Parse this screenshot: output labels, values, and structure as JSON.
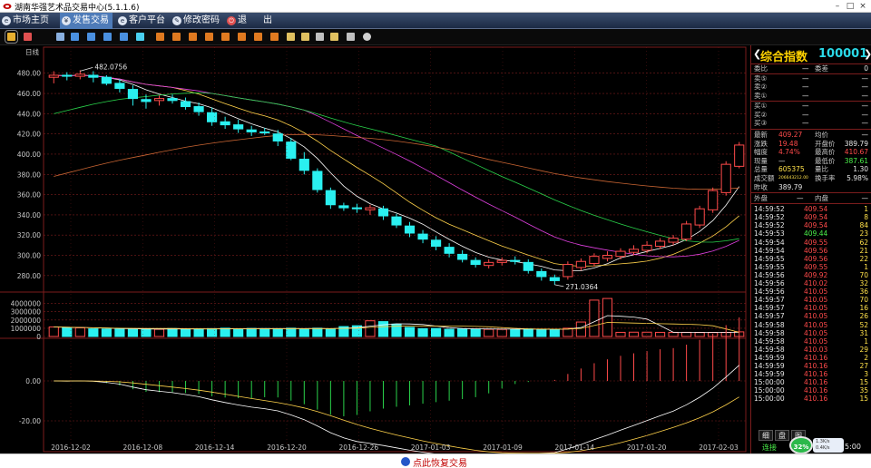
{
  "window": {
    "title": "湖南华强艺术品交易中心(5.1.1.6)",
    "buttons": [
      "–",
      "□",
      "×"
    ]
  },
  "menu": [
    {
      "label": "市场主页",
      "icon": "home-icon",
      "active": false
    },
    {
      "label": "发售交易",
      "icon": "trade-icon",
      "active": true
    },
    {
      "label": "客户平台",
      "icon": "client-icon",
      "active": false
    },
    {
      "label": "修改密码",
      "icon": "key-icon",
      "active": false
    },
    {
      "label": "退",
      "icon": "exit-icon",
      "active": false
    },
    {
      "label": "出",
      "icon": "",
      "active": false
    }
  ],
  "chart_data": {
    "type": "candlestick",
    "period_label": "日线",
    "dates": [
      "2016-12-02",
      "2016-12-08",
      "2016-12-14",
      "2016-12-20",
      "2016-12-26",
      "2017-01-03",
      "2017-01-09",
      "2017-01-14",
      "2017-01-20",
      "2017-02-03"
    ],
    "price_ticks": [
      "480.00",
      "460.00",
      "440.00",
      "420.00",
      "400.00",
      "380.00",
      "360.00",
      "340.00",
      "320.00",
      "300.00",
      "280.00"
    ],
    "high_label": "482.0756",
    "low_label": "271.0364",
    "ylim": [
      270,
      495
    ],
    "candles": [
      {
        "o": 476,
        "c": 478,
        "h": 482,
        "l": 470
      },
      {
        "o": 478,
        "c": 477,
        "h": 481,
        "l": 473
      },
      {
        "o": 477,
        "c": 479,
        "h": 483,
        "l": 474
      },
      {
        "o": 478,
        "c": 476,
        "h": 482,
        "l": 471
      },
      {
        "o": 476,
        "c": 470,
        "h": 478,
        "l": 468
      },
      {
        "o": 470,
        "c": 465,
        "h": 474,
        "l": 461
      },
      {
        "o": 464,
        "c": 455,
        "h": 468,
        "l": 448
      },
      {
        "o": 454,
        "c": 452,
        "h": 459,
        "l": 445
      },
      {
        "o": 453,
        "c": 455,
        "h": 458,
        "l": 448
      },
      {
        "o": 455,
        "c": 453,
        "h": 459,
        "l": 450
      },
      {
        "o": 452,
        "c": 447,
        "h": 456,
        "l": 444
      },
      {
        "o": 447,
        "c": 442,
        "h": 451,
        "l": 438
      },
      {
        "o": 441,
        "c": 432,
        "h": 446,
        "l": 428
      },
      {
        "o": 432,
        "c": 429,
        "h": 437,
        "l": 425
      },
      {
        "o": 429,
        "c": 425,
        "h": 434,
        "l": 421
      },
      {
        "o": 424,
        "c": 422,
        "h": 428,
        "l": 418
      },
      {
        "o": 422,
        "c": 421,
        "h": 426,
        "l": 419
      },
      {
        "o": 420,
        "c": 413,
        "h": 424,
        "l": 408
      },
      {
        "o": 412,
        "c": 396,
        "h": 416,
        "l": 394
      },
      {
        "o": 395,
        "c": 384,
        "h": 402,
        "l": 380
      },
      {
        "o": 383,
        "c": 365,
        "h": 386,
        "l": 362
      },
      {
        "o": 364,
        "c": 350,
        "h": 367,
        "l": 346
      },
      {
        "o": 349,
        "c": 347,
        "h": 352,
        "l": 344
      },
      {
        "o": 347,
        "c": 346,
        "h": 351,
        "l": 342
      },
      {
        "o": 345,
        "c": 347,
        "h": 350,
        "l": 340
      },
      {
        "o": 346,
        "c": 339,
        "h": 349,
        "l": 335
      },
      {
        "o": 338,
        "c": 330,
        "h": 341,
        "l": 327
      },
      {
        "o": 329,
        "c": 322,
        "h": 333,
        "l": 318
      },
      {
        "o": 321,
        "c": 316,
        "h": 325,
        "l": 312
      },
      {
        "o": 315,
        "c": 309,
        "h": 319,
        "l": 305
      },
      {
        "o": 308,
        "c": 302,
        "h": 312,
        "l": 298
      },
      {
        "o": 301,
        "c": 296,
        "h": 305,
        "l": 293
      },
      {
        "o": 295,
        "c": 291,
        "h": 298,
        "l": 288
      },
      {
        "o": 290,
        "c": 293,
        "h": 296,
        "l": 287
      },
      {
        "o": 293,
        "c": 295,
        "h": 298,
        "l": 290
      },
      {
        "o": 295,
        "c": 294,
        "h": 299,
        "l": 291
      },
      {
        "o": 293,
        "c": 285,
        "h": 296,
        "l": 282
      },
      {
        "o": 284,
        "c": 279,
        "h": 287,
        "l": 275
      },
      {
        "o": 278,
        "c": 275,
        "h": 281,
        "l": 271
      },
      {
        "o": 279,
        "c": 291,
        "h": 294,
        "l": 276
      },
      {
        "o": 288,
        "c": 294,
        "h": 297,
        "l": 285
      },
      {
        "o": 292,
        "c": 299,
        "h": 302,
        "l": 289
      },
      {
        "o": 297,
        "c": 300,
        "h": 304,
        "l": 294
      },
      {
        "o": 299,
        "c": 304,
        "h": 307,
        "l": 296
      },
      {
        "o": 303,
        "c": 306,
        "h": 310,
        "l": 300
      },
      {
        "o": 305,
        "c": 310,
        "h": 314,
        "l": 302
      },
      {
        "o": 309,
        "c": 314,
        "h": 317,
        "l": 306
      },
      {
        "o": 313,
        "c": 317,
        "h": 320,
        "l": 310
      },
      {
        "o": 316,
        "c": 331,
        "h": 334,
        "l": 314
      },
      {
        "o": 330,
        "c": 346,
        "h": 349,
        "l": 327
      },
      {
        "o": 345,
        "c": 364,
        "h": 367,
        "l": 342
      },
      {
        "o": 362,
        "c": 390,
        "h": 393,
        "l": 359
      },
      {
        "o": 388,
        "c": 409,
        "h": 412,
        "l": 386
      }
    ],
    "ma_colors": [
      "#ffffff",
      "#ffd24a",
      "#e040e0",
      "#29d24a",
      "#c86432"
    ],
    "volume_ticks": [
      "4000000",
      "3000000",
      "2000000",
      "1000000",
      "0"
    ],
    "volume_max": 4500000,
    "volumes": [
      1150000,
      1100000,
      1050000,
      920000,
      900000,
      880000,
      920000,
      930000,
      870000,
      960000,
      880000,
      930000,
      950000,
      1000000,
      920000,
      970000,
      950000,
      940000,
      1000000,
      920000,
      1000000,
      880000,
      1200000,
      1300000,
      1900000,
      1800000,
      1500000,
      1100000,
      950000,
      970000,
      880000,
      920000,
      900000,
      870000,
      860000,
      880000,
      920000,
      850000,
      870000,
      1000000,
      1750000,
      4400000,
      4600000,
      500000,
      520000,
      520000,
      500000,
      500000,
      500000,
      480000,
      480000,
      490000,
      560000
    ],
    "macd_ticks": [
      "0.00",
      "-20.00"
    ],
    "macd_range": [
      -30,
      20
    ]
  },
  "quote_panel": {
    "name": "综合指数",
    "code": "100001",
    "order_rows": [
      {
        "label": "委比",
        "value": "—",
        "label2": "委差",
        "value2": "0"
      },
      {
        "label": "卖⑤",
        "value": "—",
        "value2": "—"
      },
      {
        "label": "卖②",
        "value": "—",
        "value2": "—"
      },
      {
        "label": "卖①",
        "value": "—",
        "value2": "—"
      },
      {
        "label": "买①",
        "value": "—",
        "value2": "—"
      },
      {
        "label": "买②",
        "value": "—",
        "value2": "—"
      },
      {
        "label": "买③",
        "value": "—",
        "value2": "—"
      }
    ],
    "stats": [
      {
        "l1": "最新",
        "v1": "409.27",
        "l2": "均价",
        "v2": "—"
      },
      {
        "l1": "涨跌",
        "v1": "19.48",
        "l2": "开盘价",
        "v2": "389.79"
      },
      {
        "l1": "幅度",
        "v1": "4.74%",
        "l2": "最高价",
        "v2": "410.67"
      },
      {
        "l1": "现量",
        "v1": "—",
        "l2": "最低价",
        "v2": "387.61"
      },
      {
        "l1": "总量",
        "v1": "605375",
        "l2": "量比",
        "v2": "1.30"
      },
      {
        "l1": "成交额",
        "v1": "206643212.00",
        "l2": "换手率",
        "v2": "5.98%"
      },
      {
        "l1": "昨收",
        "v1": "389.79",
        "l2": "",
        "v2": ""
      }
    ],
    "outer_label": "外盘",
    "outer_value": "—",
    "inner_label": "内盘",
    "inner_value": "—",
    "ticks": [
      {
        "t": "14:59:52",
        "p": "409.54",
        "q": "1"
      },
      {
        "t": "14:59:52",
        "p": "409.54",
        "q": "8"
      },
      {
        "t": "14:59:52",
        "p": "409.54",
        "q": "84"
      },
      {
        "t": "14:59:53",
        "p": "409.44",
        "q": "23"
      },
      {
        "t": "14:59:54",
        "p": "409.55",
        "q": "62"
      },
      {
        "t": "14:59:54",
        "p": "409.56",
        "q": "21"
      },
      {
        "t": "14:59:55",
        "p": "409.56",
        "q": "22"
      },
      {
        "t": "14:59:55",
        "p": "409.55",
        "q": "1"
      },
      {
        "t": "14:59:56",
        "p": "409.92",
        "q": "70"
      },
      {
        "t": "14:59:56",
        "p": "410.02",
        "q": "32"
      },
      {
        "t": "14:59:56",
        "p": "410.05",
        "q": "36"
      },
      {
        "t": "14:59:57",
        "p": "410.05",
        "q": "70"
      },
      {
        "t": "14:59:57",
        "p": "410.05",
        "q": "16"
      },
      {
        "t": "14:59:57",
        "p": "410.05",
        "q": "26"
      },
      {
        "t": "14:59:58",
        "p": "410.05",
        "q": "52"
      },
      {
        "t": "14:59:58",
        "p": "410.05",
        "q": "31"
      },
      {
        "t": "14:59:58",
        "p": "410.05",
        "q": "1"
      },
      {
        "t": "14:59:58",
        "p": "410.03",
        "q": "29"
      },
      {
        "t": "14:59:59",
        "p": "410.16",
        "q": "2"
      },
      {
        "t": "14:59:59",
        "p": "410.16",
        "q": "27"
      },
      {
        "t": "14:59:59",
        "p": "410.16",
        "q": "3"
      },
      {
        "t": "15:00:00",
        "p": "410.16",
        "q": "15"
      },
      {
        "t": "15:00:00",
        "p": "410.16",
        "q": "35"
      },
      {
        "t": "15:00:00",
        "p": "410.16",
        "q": "15"
      }
    ],
    "tabs": [
      "细",
      "盘",
      "图"
    ],
    "status": {
      "connection": "连接",
      "time": "5:00",
      "speed": "32%",
      "up": "1.3K/s",
      "down": "0.4K/s"
    }
  },
  "footer": {
    "restore_label": "点此恢复交易"
  },
  "colors": {
    "up": "#ff4a4a",
    "down": "#2af0f0",
    "grid": "#7b1d1d",
    "axis_text": "#c8c8c8",
    "accent": "#ffd200"
  }
}
